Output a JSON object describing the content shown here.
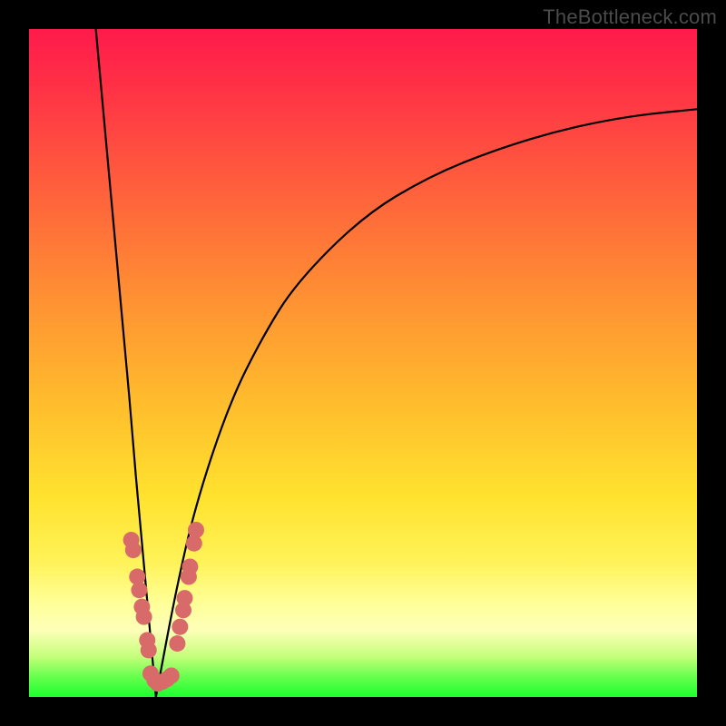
{
  "watermark": "TheBottleneck.com",
  "colors": {
    "dot": "#d86a6a",
    "curve": "#000000"
  },
  "chart_data": {
    "type": "line",
    "title": "",
    "xlabel": "",
    "ylabel": "",
    "xlim": [
      0,
      100
    ],
    "ylim": [
      0,
      100
    ],
    "grid": false,
    "description": "Bottleneck-style V-curve: steep descending limb (left) and a decelerating ascending limb (right) meeting near x≈19. Coral dots annotate both limbs in the low-y region just above the minimum.",
    "minimum": {
      "x": 19,
      "y": 0
    },
    "series": [
      {
        "name": "left-limb",
        "x": [
          10,
          11,
          12,
          13,
          14,
          15,
          16,
          17,
          18,
          19
        ],
        "y": [
          100,
          89,
          78,
          67,
          56,
          45,
          33,
          22,
          11,
          0
        ]
      },
      {
        "name": "right-limb",
        "x": [
          19,
          22,
          25,
          30,
          35,
          40,
          50,
          60,
          70,
          80,
          90,
          100
        ],
        "y": [
          0,
          16,
          29,
          44,
          54,
          62,
          72,
          78,
          82,
          85,
          87,
          88
        ]
      }
    ],
    "dots_left_limb": [
      {
        "x": 15.3,
        "y": 23.5
      },
      {
        "x": 15.6,
        "y": 22.0
      },
      {
        "x": 16.2,
        "y": 18.0
      },
      {
        "x": 16.5,
        "y": 16.0
      },
      {
        "x": 16.9,
        "y": 13.5
      },
      {
        "x": 17.2,
        "y": 12.0
      },
      {
        "x": 17.7,
        "y": 8.5
      },
      {
        "x": 17.9,
        "y": 7.0
      }
    ],
    "dots_bottom": [
      {
        "x": 18.2,
        "y": 3.5
      },
      {
        "x": 18.8,
        "y": 2.5
      },
      {
        "x": 19.3,
        "y": 2.0
      },
      {
        "x": 20.0,
        "y": 2.3
      },
      {
        "x": 20.7,
        "y": 2.7
      },
      {
        "x": 21.3,
        "y": 3.2
      }
    ],
    "dots_right_limb": [
      {
        "x": 22.2,
        "y": 8.0
      },
      {
        "x": 22.6,
        "y": 10.5
      },
      {
        "x": 23.1,
        "y": 13.0
      },
      {
        "x": 23.3,
        "y": 14.8
      },
      {
        "x": 23.9,
        "y": 18.0
      },
      {
        "x": 24.1,
        "y": 19.5
      },
      {
        "x": 24.7,
        "y": 23.0
      },
      {
        "x": 25.0,
        "y": 25.0
      }
    ]
  }
}
